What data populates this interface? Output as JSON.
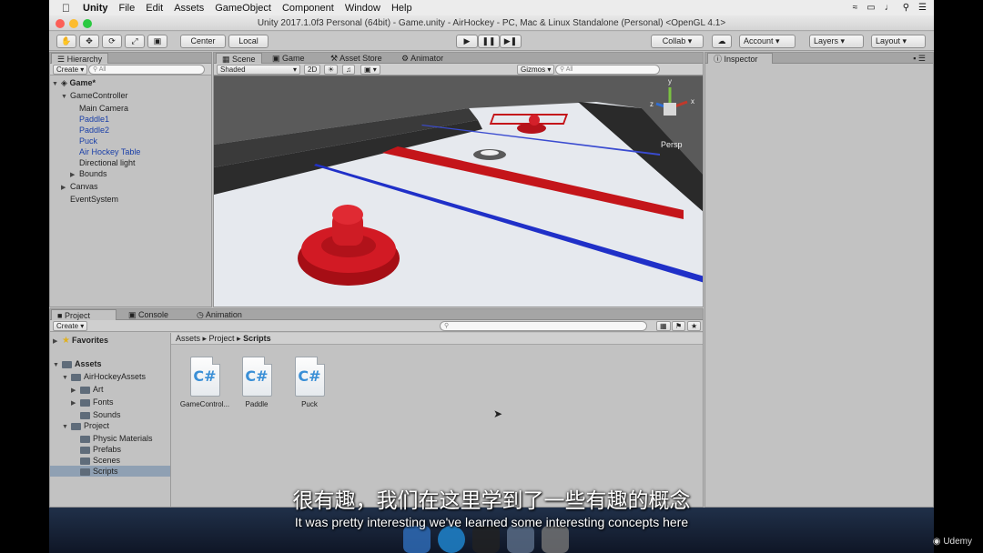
{
  "menubar": {
    "app": "Unity",
    "items": [
      "File",
      "Edit",
      "Assets",
      "GameObject",
      "Component",
      "Window",
      "Help"
    ]
  },
  "window": {
    "title": "Unity 2017.1.0f3 Personal (64bit) - Game.unity - AirHockey - PC, Mac & Linux Standalone (Personal) <OpenGL 4.1>"
  },
  "toolbar": {
    "pivot": "Center",
    "space": "Local",
    "collab": "Collab ▾",
    "account": "Account",
    "layers": "Layers",
    "layout": "Layout"
  },
  "hierarchy": {
    "tab": "Hierarchy",
    "create": "Create ▾",
    "search_placeholder": "All",
    "scene": "Game*",
    "items": [
      "GameController",
      "Main Camera",
      "Paddle1",
      "Paddle2",
      "Puck",
      "Air Hockey Table",
      "Directional light",
      "Bounds",
      "Canvas",
      "EventSystem"
    ]
  },
  "scene": {
    "tabs": [
      "Scene",
      "Game",
      "Asset Store",
      "Animator"
    ],
    "shading": "Shaded",
    "mode2d": "2D",
    "gizmos": "Gizmos ▾",
    "search_placeholder": "All",
    "persp": "Persp",
    "axis_y": "y",
    "axis_x": "x",
    "axis_z": "z"
  },
  "inspector": {
    "tab": "Inspector"
  },
  "project": {
    "tabs": [
      "Project",
      "Console",
      "Animation"
    ],
    "create": "Create ▾",
    "favorites": "Favorites",
    "tree": [
      "Assets",
      "AirHockeyAssets",
      "Art",
      "Fonts",
      "Sounds",
      "Project",
      "Physic Materials",
      "Prefabs",
      "Scenes",
      "Scripts"
    ],
    "breadcrumb": [
      "Assets",
      "Project",
      "Scripts"
    ],
    "assets": [
      "GameControl...",
      "Paddle",
      "Puck"
    ],
    "icon_label": "C#"
  },
  "subtitles": {
    "zh": "很有趣，我们在这里学到了一些有趣的概念",
    "en": "It was pretty interesting we've learned some interesting concepts here"
  },
  "watermark": "Udemy"
}
